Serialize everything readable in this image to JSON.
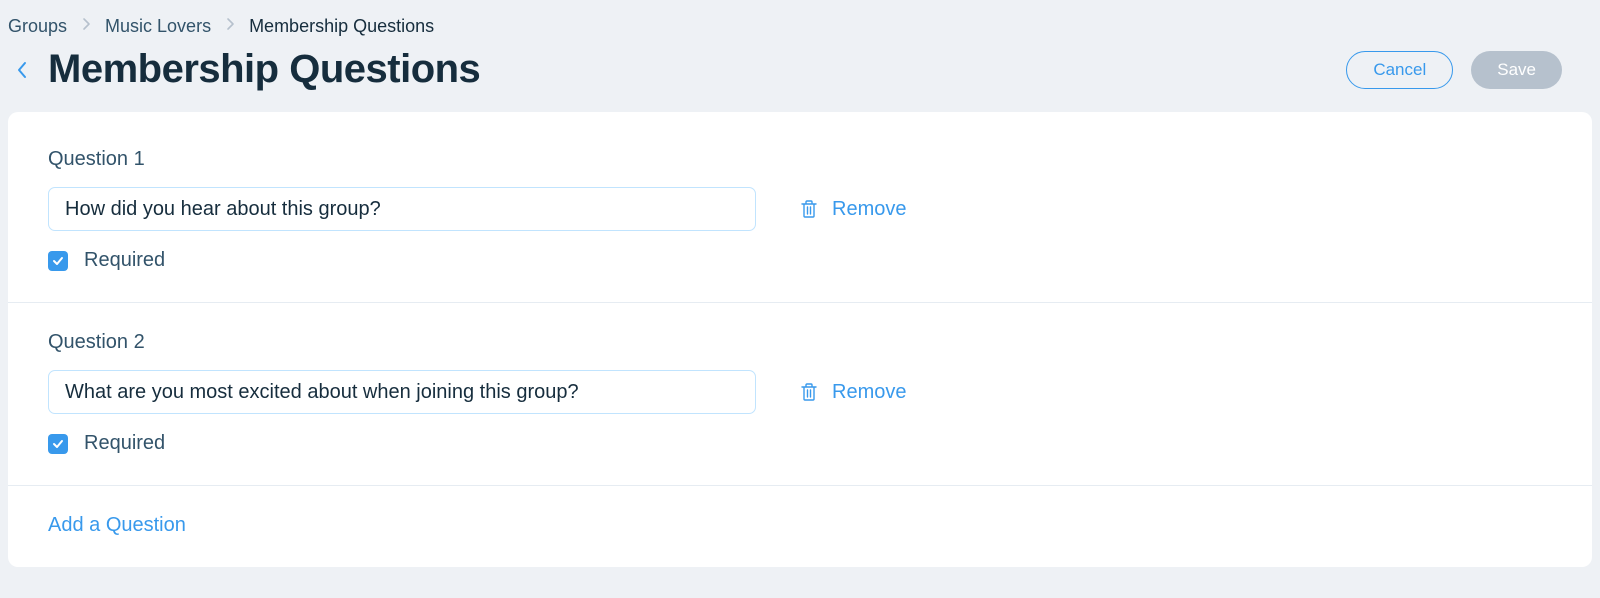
{
  "breadcrumb": {
    "items": [
      "Groups",
      "Music Lovers",
      "Membership Questions"
    ]
  },
  "header": {
    "title": "Membership Questions",
    "cancel_label": "Cancel",
    "save_label": "Save"
  },
  "questions": [
    {
      "heading": "Question 1",
      "value": "How did you hear about this group?",
      "remove_label": "Remove",
      "required_label": "Required",
      "required_checked": true
    },
    {
      "heading": "Question 2",
      "value": "What are you most excited about when joining this group?",
      "remove_label": "Remove",
      "required_label": "Required",
      "required_checked": true
    }
  ],
  "add_question_label": "Add a Question"
}
